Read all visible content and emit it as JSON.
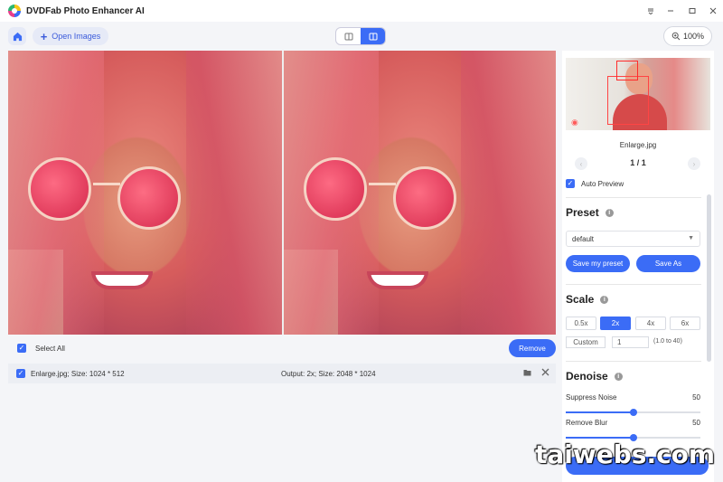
{
  "app": {
    "title": "DVDFab Photo Enhancer AI"
  },
  "toolbar": {
    "open_label": "Open Images",
    "zoom": "100%"
  },
  "files": {
    "select_all": "Select All",
    "remove": "Remove",
    "items": [
      {
        "name": "Enlarge.jpg; Size: 1024 * 512",
        "output": "Output: 2x; Size: 2048 * 1024"
      }
    ]
  },
  "sidebar": {
    "thumb_name": "Enlarge.jpg",
    "pager": "1 / 1",
    "auto_preview": "Auto Preview",
    "preset": {
      "title": "Preset",
      "selected": "default",
      "save_my": "Save my preset",
      "save_as": "Save As"
    },
    "scale": {
      "title": "Scale",
      "options": [
        "0.5x",
        "2x",
        "4x",
        "6x"
      ],
      "active": "2x",
      "custom_label": "Custom",
      "custom_value": "1",
      "range": "(1.0 to 40)"
    },
    "denoise": {
      "title": "Denoise",
      "suppress_label": "Suppress Noise",
      "suppress_value": "50",
      "blur_label": "Remove Blur",
      "blur_value": "50"
    }
  },
  "watermark": "taiwebs.com",
  "colors": {
    "accent": "#3b6cf6",
    "background": "#f4f5f8"
  },
  "icons": [
    "home-icon",
    "plus-icon",
    "single-view-icon",
    "split-view-icon",
    "zoom-icon",
    "folder-icon",
    "close-icon",
    "eye-icon",
    "info-icon",
    "chevron-left-icon",
    "chevron-right-icon"
  ]
}
